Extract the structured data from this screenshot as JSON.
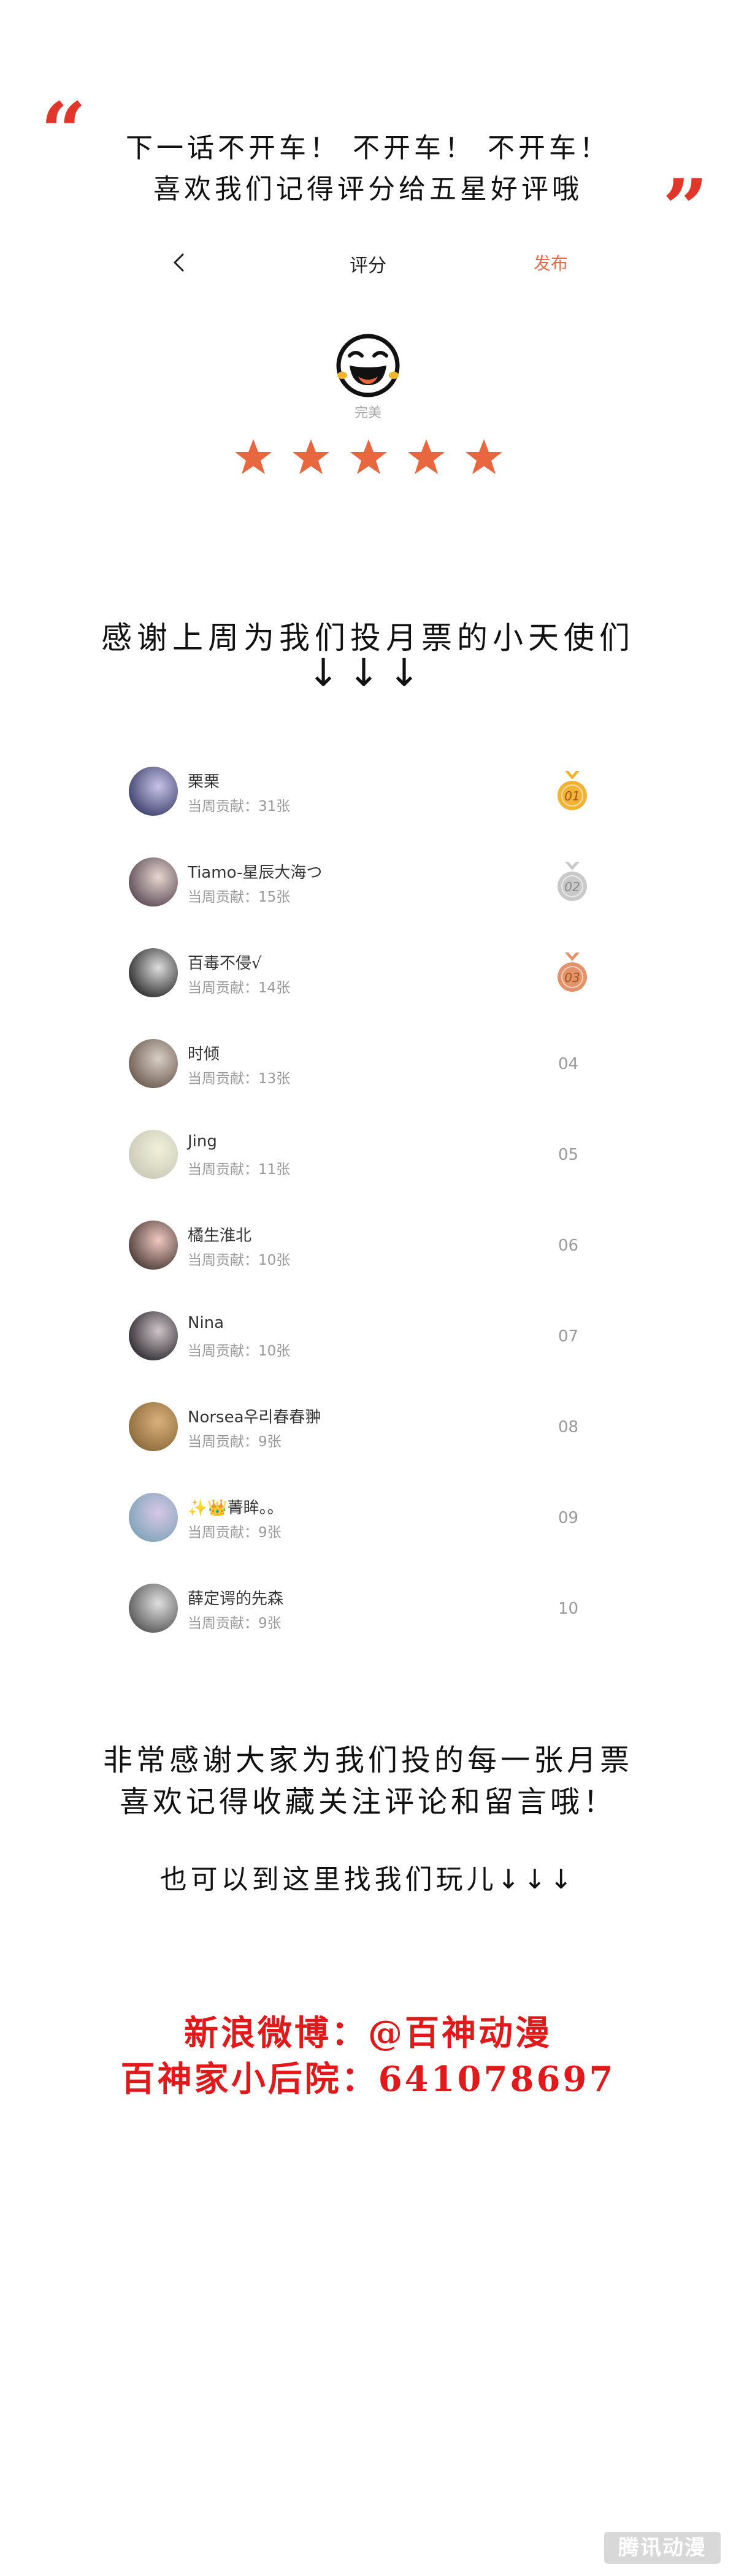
{
  "intro": {
    "open_quote": "“",
    "close_quote": "”",
    "line1": "下一话不开车！ 不开车！ 不开车！",
    "line2": "喜欢我们记得评分给五星好评哦"
  },
  "rating_screen": {
    "back_icon": "chevron-left-icon",
    "title": "评分",
    "publish_label": "发布",
    "face_icon": "laughing-face-icon",
    "face_label": "完美",
    "stars": 5,
    "star_color": "#e8673f",
    "accent_color": "#e96a4a"
  },
  "thanks": {
    "title": "感谢上周为我们投月票的小天使们",
    "arrows": "↓↓↓"
  },
  "ranking": {
    "rows": [
      {
        "name": "栗栗",
        "contribution": "当周贡献：31张",
        "rank": "01",
        "medal": "gold"
      },
      {
        "name": "Tiamo-星辰大海つ",
        "contribution": "当周贡献：15张",
        "rank": "02",
        "medal": "silver"
      },
      {
        "name": "百毒不侵√",
        "contribution": "当周贡献：14张",
        "rank": "03",
        "medal": "bronze"
      },
      {
        "name": "时倾",
        "contribution": "当周贡献：13张",
        "rank": "04",
        "medal": ""
      },
      {
        "name": "Jing",
        "contribution": "当周贡献：11张",
        "rank": "05",
        "medal": ""
      },
      {
        "name": "橘生淮北",
        "contribution": "当周贡献：10张",
        "rank": "06",
        "medal": ""
      },
      {
        "name": "Nina",
        "contribution": "当周贡献：10张",
        "rank": "07",
        "medal": ""
      },
      {
        "name": "Norsea우리春春翀",
        "contribution": "当周贡献：9张",
        "rank": "08",
        "medal": ""
      },
      {
        "name": "✨👑菁眸。。",
        "contribution": "当周贡献：9张",
        "rank": "09",
        "medal": ""
      },
      {
        "name": "薛定谔的先森",
        "contribution": "当周贡献：9张",
        "rank": "10",
        "medal": ""
      }
    ]
  },
  "closing": {
    "line1": "非常感谢大家为我们投的每一张月票",
    "line2": "喜欢记得收藏关注评论和留言哦！",
    "line3": "也可以到这里找我们玩儿↓↓↓"
  },
  "contact": {
    "weibo": "新浪微博：@百神动漫",
    "courtyard": "百神家小后院：641078697",
    "color": "#e1191b"
  },
  "watermark": "腾讯动漫"
}
